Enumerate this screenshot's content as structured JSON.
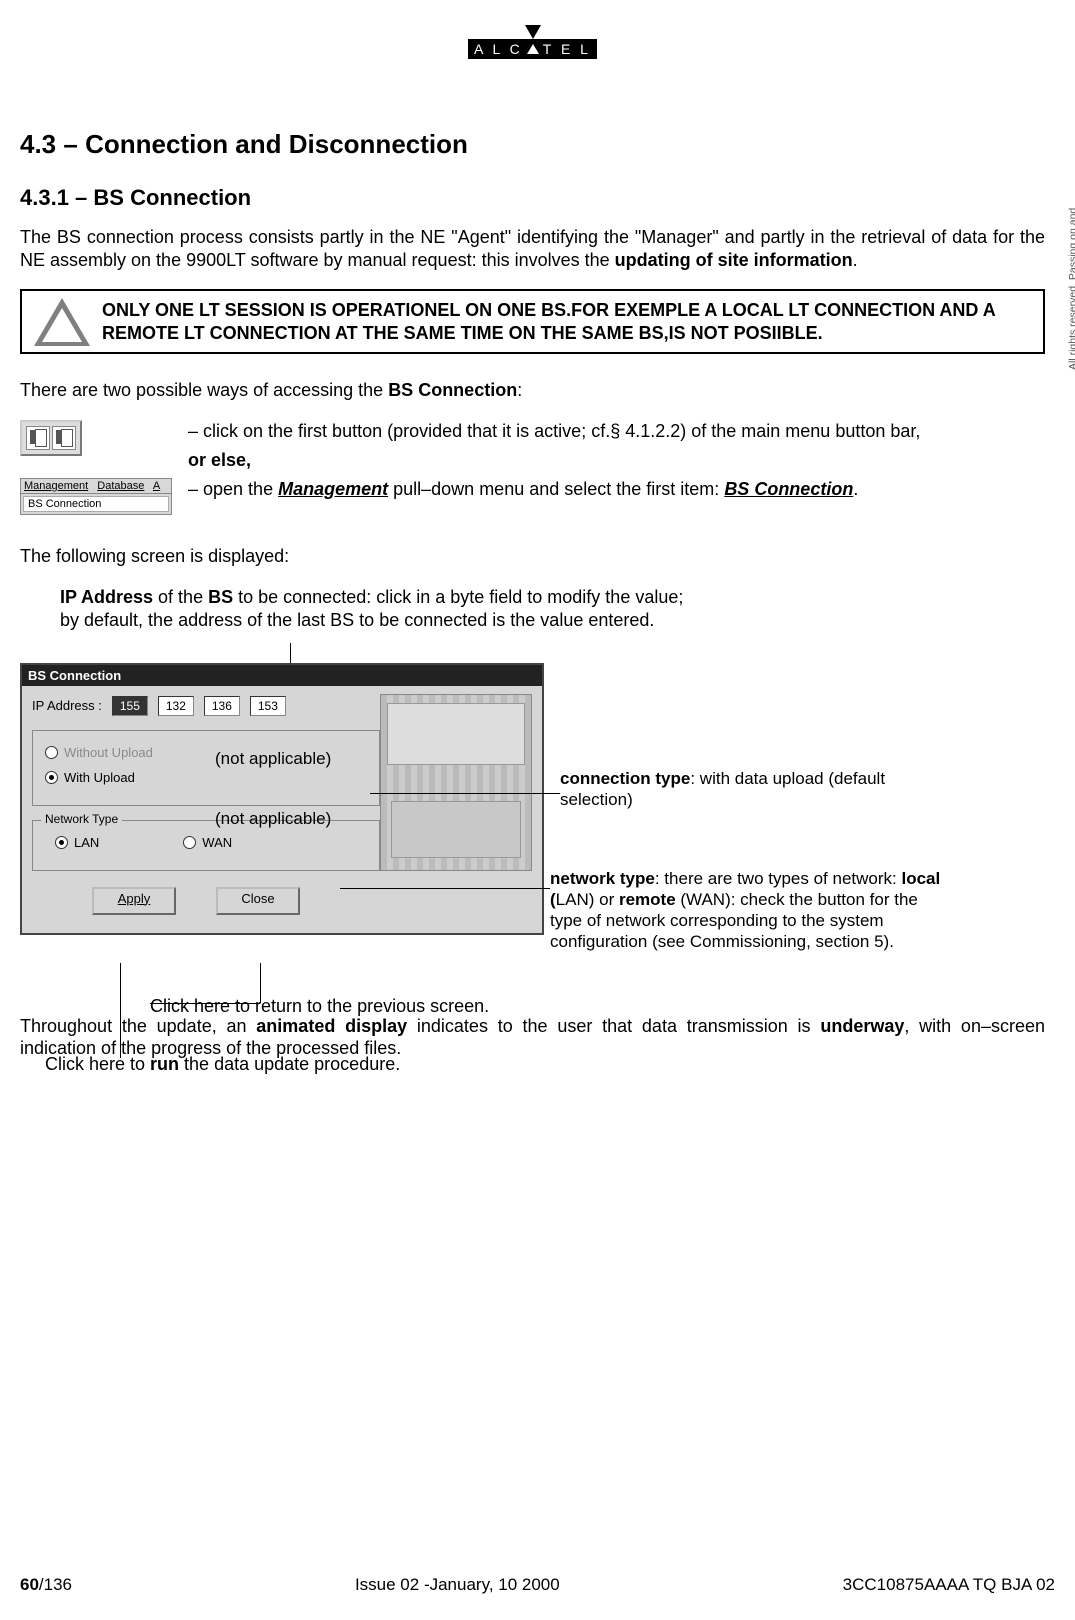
{
  "logo_text_left": "A L C",
  "logo_text_right": "T E L",
  "section_number": "4.3",
  "section_dash": "–",
  "section_title": "Connection and Disconnection",
  "subsection": "4.3.1 – BS Connection",
  "intro_a": "The BS connection process consists partly in the NE \"Agent\" identifying the \"Manager\" and partly in the retrieval of data for the NE assembly on the 9900LT software by manual request: this involves the ",
  "intro_b": "updating of site information",
  "intro_c": ".",
  "warn": "ONLY ONE LT SESSION IS OPERATIONEL ON ONE BS.FOR EXEMPLE A LOCAL LT CONNECTION AND A REMOTE LT CONNECTION AT THE SAME TIME ON THE SAME BS,IS NOT POSIIBLE.",
  "access_intro_a": "There are two possible ways of accessing the ",
  "access_intro_b": "BS Connection",
  "access_intro_c": ":",
  "access1": "– click on the first button (provided that it is active; cf.§ 4.1.2.2) of the main menu button bar,",
  "or_else": "or else,",
  "access2_pre": "– open the ",
  "access2_mgmt": "Management",
  "access2_mid": " pull–down menu and select the first item: ",
  "access2_bs": "BS Connection",
  "access2_post": ".",
  "menu_management": "Management",
  "menu_database": "Database",
  "menu_a": "A",
  "menu_bs": "BS Connection",
  "following": "The following screen is displayed:",
  "ip_note_l1_a": "IP Address",
  "ip_note_l1_b": " of the ",
  "ip_note_l1_c": "BS",
  "ip_note_l1_d": " to be connected: click in a byte field to modify the value;",
  "ip_note_l2": "by default, the address of the last BS to be connected is the value entered.",
  "dlg_title": "BS Connection",
  "ip_label": "IP Address :",
  "ip": [
    "155",
    "132",
    "136",
    "153"
  ],
  "radio_without": "Without Upload",
  "radio_with": "With Upload",
  "nt_label": "Network Type",
  "lan": "LAN",
  "wan": "WAN",
  "apply": "Apply",
  "close": "Close",
  "na": "(not applicable)",
  "callout_conn_a": "connection type",
  "callout_conn_b": ": with data upload (default selection)",
  "callout_net_a": "network type",
  "callout_net_b": ": there are two types of network: ",
  "callout_net_c": "local (",
  "callout_net_d": "LAN) or ",
  "callout_net_e": "remote",
  "callout_net_f": " (WAN): check the button for the type of network corresponding to the system configuration (see Commissioning, section 5).",
  "close_note": "Click here to return to the previous screen.",
  "apply_note_a": "Click here to ",
  "apply_note_b": "run",
  "apply_note_c": " the data update procedure.",
  "throughout_a": "Throughout the update, an ",
  "throughout_b": "animated display",
  "throughout_c": " indicates to the user that data transmission is ",
  "throughout_d": "underway",
  "throughout_e": ", with on–screen indication of the progress of the processed files.",
  "sidenote": "All rights reserved. Passing on and copying of this document, use and communication of its contents not permitted without written authorization from ALCATEL",
  "page_cur": "60",
  "page_total": "/136",
  "issue": "Issue 02 -January, 10 2000",
  "docref": "3CC10875AAAA TQ BJA 02"
}
